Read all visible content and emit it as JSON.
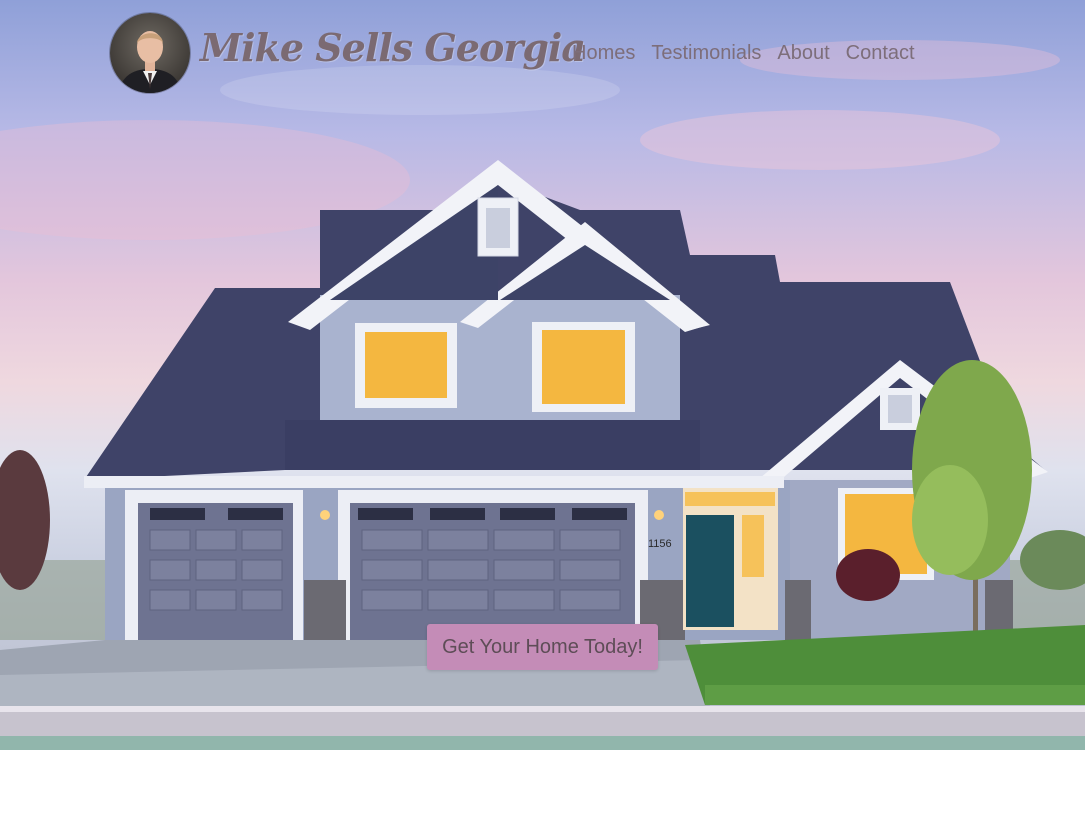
{
  "header": {
    "brand": "Mike Sells Georgia",
    "nav": [
      {
        "label": "Homes"
      },
      {
        "label": "Testimonials"
      },
      {
        "label": "About"
      },
      {
        "label": "Contact"
      }
    ]
  },
  "hero": {
    "cta_label": "Get Your Home Today!",
    "house_number": "1156"
  },
  "colors": {
    "brand_text": "#7b6a72",
    "nav_text": "#7d6e7a",
    "cta_background": "#c48cb7",
    "band": "#91b6ac"
  }
}
